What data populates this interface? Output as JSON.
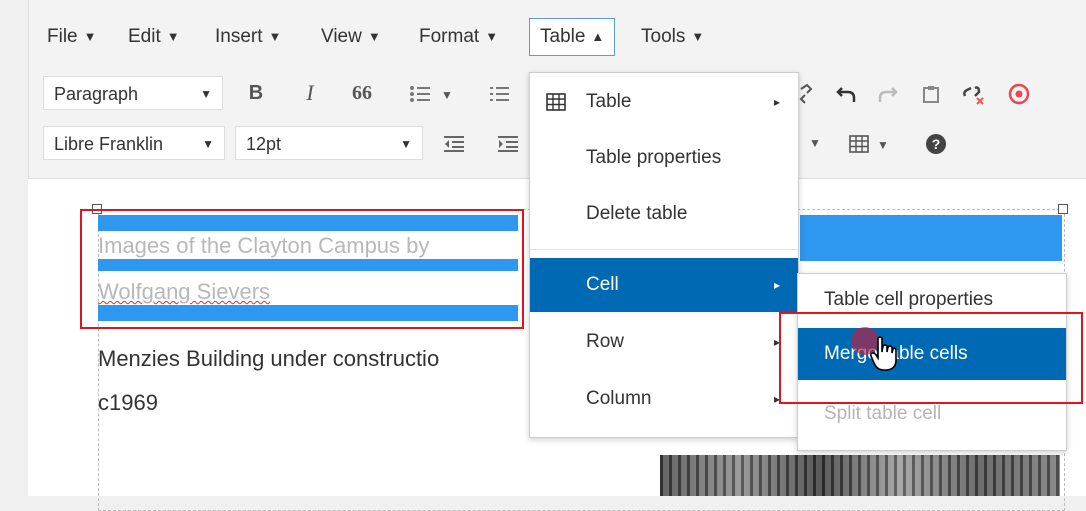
{
  "menubar": {
    "items": [
      {
        "label": "File",
        "caret": "▼"
      },
      {
        "label": "Edit",
        "caret": "▼"
      },
      {
        "label": "Insert",
        "caret": "▼"
      },
      {
        "label": "View",
        "caret": "▼"
      },
      {
        "label": "Format",
        "caret": "▼"
      },
      {
        "label": "Table",
        "caret": "▲"
      },
      {
        "label": "Tools",
        "caret": "▼"
      }
    ]
  },
  "toolbar": {
    "format_select": "Paragraph",
    "font_select": "Libre Franklin",
    "size_select": "12pt",
    "bold": "B",
    "italic": "I",
    "blockquote": "66",
    "help": "?"
  },
  "table_menu": {
    "items": [
      "Table",
      "Table properties",
      "Delete table",
      "Cell",
      "Row",
      "Column"
    ],
    "submenu_arrow": "▸"
  },
  "cell_submenu": {
    "items": [
      "Table cell properties",
      "Merge table cells",
      "Split table cell"
    ]
  },
  "editor": {
    "caption_line1": "Images of the Clayton Campus by",
    "caption_line2": "Wolfgang Sievers",
    "body_line1": "Menzies Building under constructio",
    "body_line2": "c1969"
  },
  "colors": {
    "selection": "#2e97f0",
    "menu_highlight": "#0069b4",
    "annotation_red": "#e0141e"
  }
}
